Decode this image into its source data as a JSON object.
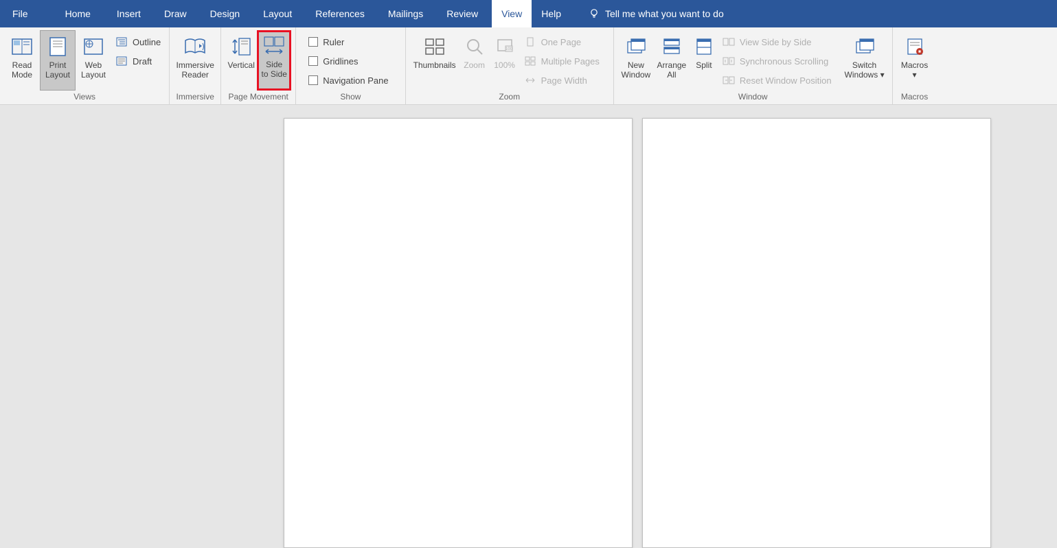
{
  "tabs": {
    "file": "File",
    "home": "Home",
    "insert": "Insert",
    "draw": "Draw",
    "design": "Design",
    "layout": "Layout",
    "references": "References",
    "mailings": "Mailings",
    "review": "Review",
    "view": "View",
    "help": "Help"
  },
  "tell_me": "Tell me what you want to do",
  "groups": {
    "views": {
      "label": "Views",
      "read_mode": "Read\nMode",
      "print_layout": "Print\nLayout",
      "web_layout": "Web\nLayout",
      "outline": "Outline",
      "draft": "Draft"
    },
    "immersive": {
      "label": "Immersive",
      "immersive_reader": "Immersive\nReader"
    },
    "page_movement": {
      "label": "Page Movement",
      "vertical": "Vertical",
      "side_to_side": "Side\nto Side"
    },
    "show": {
      "label": "Show",
      "ruler": "Ruler",
      "gridlines": "Gridlines",
      "navigation_pane": "Navigation Pane"
    },
    "zoom": {
      "label": "Zoom",
      "thumbnails": "Thumbnails",
      "zoom": "Zoom",
      "hundred": "100%",
      "one_page": "One Page",
      "multiple_pages": "Multiple Pages",
      "page_width": "Page Width"
    },
    "window": {
      "label": "Window",
      "new_window": "New\nWindow",
      "arrange_all": "Arrange\nAll",
      "split": "Split",
      "view_side_by_side": "View Side by Side",
      "synchronous_scrolling": "Synchronous Scrolling",
      "reset_window_position": "Reset Window Position",
      "switch_windows": "Switch\nWindows"
    },
    "macros": {
      "label": "Macros",
      "macros": "Macros"
    }
  }
}
